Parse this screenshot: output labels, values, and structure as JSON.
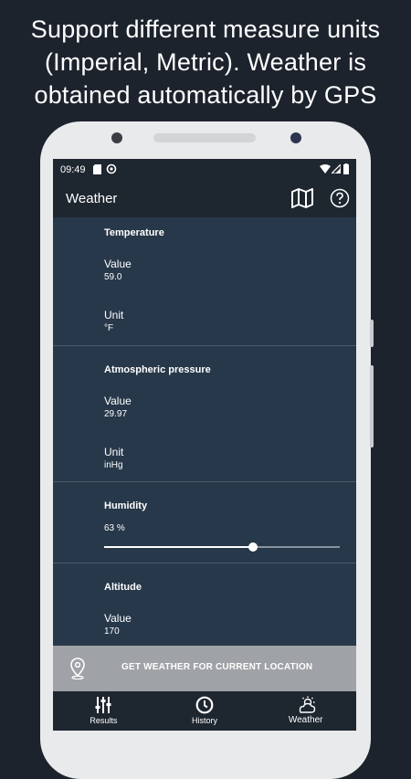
{
  "headline": {
    "line1": "Support different measure units",
    "line2": "(Imperial, Metric). Weather is",
    "line3": "obtained automatically by GPS"
  },
  "status_bar": {
    "time": "09:49"
  },
  "app_bar": {
    "title": "Weather",
    "icons": [
      "map-icon",
      "help-icon"
    ]
  },
  "temperature": {
    "title": "Temperature",
    "value_label": "Value",
    "value": "59.0",
    "unit_label": "Unit",
    "unit": "°F"
  },
  "pressure": {
    "title": "Atmospheric pressure",
    "value_label": "Value",
    "value": "29.97",
    "unit_label": "Unit",
    "unit": "inHg"
  },
  "humidity": {
    "title": "Humidity",
    "value": "63 %",
    "level_fraction": 0.63
  },
  "altitude": {
    "title": "Altitude",
    "value_label": "Value",
    "value": "170"
  },
  "cta": {
    "label": "GET WEATHER FOR CURRENT LOCATION",
    "icon": "location-pin-icon"
  },
  "bottom_nav": {
    "items": [
      {
        "label": "Results",
        "icon": "sliders-icon"
      },
      {
        "label": "History",
        "icon": "clock-icon"
      },
      {
        "label": "Weather",
        "icon": "weather-cloud-sun-icon"
      }
    ],
    "active": "Weather"
  },
  "colors": {
    "page_background": "#1d232d",
    "screen_background": "#27384a",
    "bar_background": "#1e2630",
    "button_background": "#9fa2a6"
  }
}
